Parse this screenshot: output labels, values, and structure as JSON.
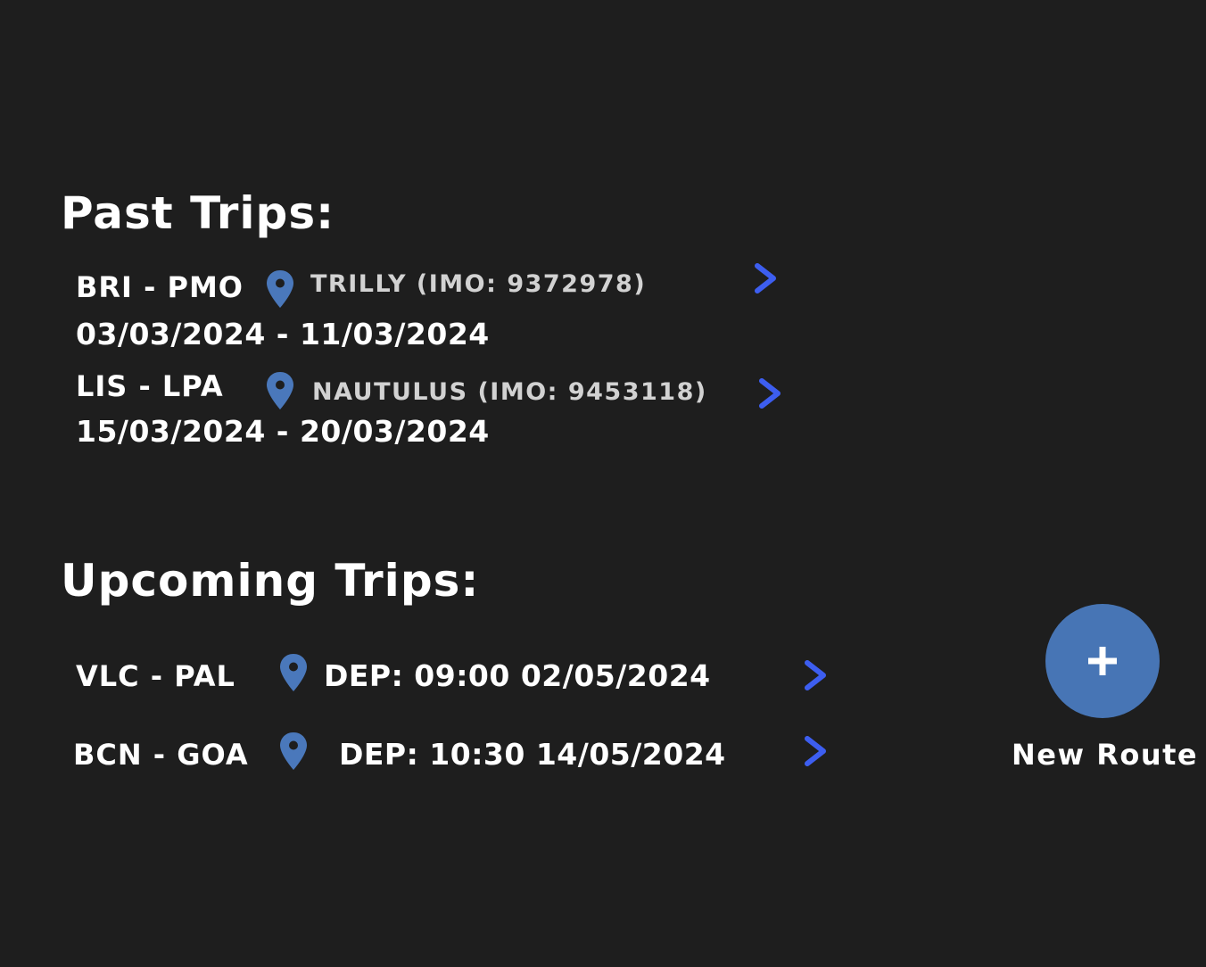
{
  "past_trips": {
    "title": "Past Trips:",
    "items": [
      {
        "route": "BRI - PMO",
        "vessel": "TRILLY (IMO: 9372978)",
        "dates": "03/03/2024 - 11/03/2024",
        "location_icon": "map-pin-icon",
        "action_icon": "chevron-right-icon"
      },
      {
        "route": "LIS - LPA",
        "vessel": "NAUTULUS (IMO: 9453118)",
        "dates": "15/03/2024 - 20/03/2024",
        "location_icon": "map-pin-icon",
        "action_icon": "chevron-right-icon"
      }
    ]
  },
  "upcoming_trips": {
    "title": "Upcoming Trips:",
    "items": [
      {
        "route": "VLC - PAL",
        "departure": "DEP: 09:00 02/05/2024",
        "location_icon": "map-pin-icon",
        "action_icon": "chevron-right-icon"
      },
      {
        "route": "BCN - GOA",
        "departure": "DEP: 10:30 14/05/2024",
        "location_icon": "map-pin-icon",
        "action_icon": "chevron-right-icon"
      }
    ]
  },
  "new_route": {
    "icon": "plus-icon",
    "label": "New Route"
  },
  "colors": {
    "background": "#1e1e1e",
    "text": "#ffffff",
    "muted_text": "#d2d2d2",
    "pin": "#4a78bb",
    "chevron": "#3d5ef0",
    "fab": "#4775b5"
  }
}
